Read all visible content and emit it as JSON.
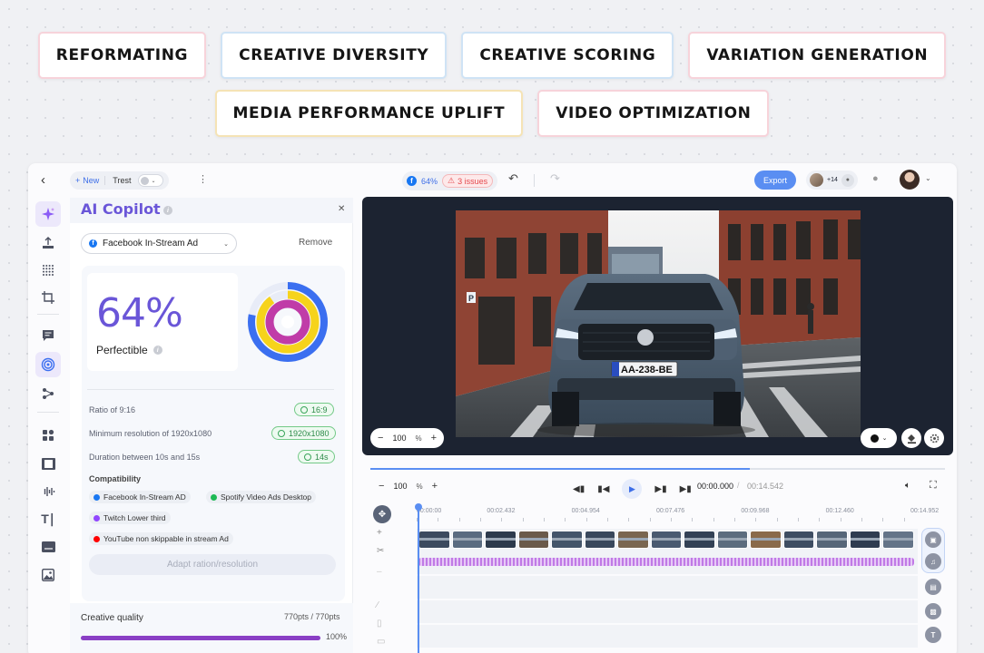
{
  "chips": {
    "row1": [
      {
        "label": "REFORMATING",
        "tone": "pink"
      },
      {
        "label": "CREATIVE DIVERSITY",
        "tone": "blue"
      },
      {
        "label": "CREATIVE SCORING",
        "tone": "blue"
      },
      {
        "label": "VARIATION GENERATION",
        "tone": "pink"
      }
    ],
    "row2": [
      {
        "label": "MEDIA PERFORMANCE UPLIFT",
        "tone": "yellow"
      },
      {
        "label": "VIDEO OPTIMIZATION",
        "tone": "pink"
      }
    ]
  },
  "topbar": {
    "back_icon": "chevron-left-icon",
    "new_label": "New",
    "doc_name": "Trest",
    "status_score": "64%",
    "issues_label": "3 issues",
    "export_label": "Export",
    "collaborators": "+14"
  },
  "rail": {
    "items": [
      "sparkle-icon",
      "upload-icon",
      "grid-dots-icon",
      "crop-icon",
      "comment-icon",
      "target-icon",
      "nodes-icon",
      "shapes-icon",
      "film-icon",
      "audio-wave-icon",
      "text-icon",
      "subtitle-icon",
      "image-icon"
    ],
    "active": "sparkle-icon"
  },
  "copilot": {
    "title": "AI Copilot",
    "format": "Facebook In-Stream Ad",
    "remove_label": "Remove",
    "score": "64%",
    "score_label": "Perfectible",
    "donut_rings": [
      {
        "color": "#3b6ff0",
        "value": 0.78
      },
      {
        "color": "#f6d31c",
        "value": 0.9
      },
      {
        "color": "#c03ca8",
        "value": 1.0
      }
    ],
    "criteria": [
      {
        "label": "Ratio of 9:16",
        "value": "16:9"
      },
      {
        "label": "Minimum resolution of 1920x1080",
        "value": "1920x1080"
      },
      {
        "label": "Duration between 10s and 15s",
        "value": "14s"
      }
    ],
    "compat_title": "Compatibility",
    "compat": [
      {
        "label": "Facebook In-Stream AD",
        "color": "#1877f2"
      },
      {
        "label": "Spotify Video Ads Desktop",
        "color": "#1db954"
      },
      {
        "label": "Twitch Lower third",
        "color": "#9146ff"
      },
      {
        "label": "YouTube non skippable in stream Ad",
        "color": "#ff0000"
      }
    ],
    "adapt_label": "Adapt ration/resolution",
    "quality_label": "Creative quality",
    "quality_pts": "770pts / 770pts",
    "quality_pct": "100%",
    "quality_value": 1.0
  },
  "preview": {
    "zoom_value": "100",
    "zoom_unit": "%",
    "plate": "AA-238-BE",
    "sign": "P"
  },
  "timeline": {
    "zoom_value": "100",
    "zoom_unit": "%",
    "progress": 0.66,
    "time_current": "00:00.000",
    "time_total": "00:14.542",
    "ruler": [
      "00:00:00",
      "00:02.432",
      "00:04.954",
      "00:07.476",
      "00:09.968",
      "00:12.460",
      "00:14.952"
    ]
  }
}
